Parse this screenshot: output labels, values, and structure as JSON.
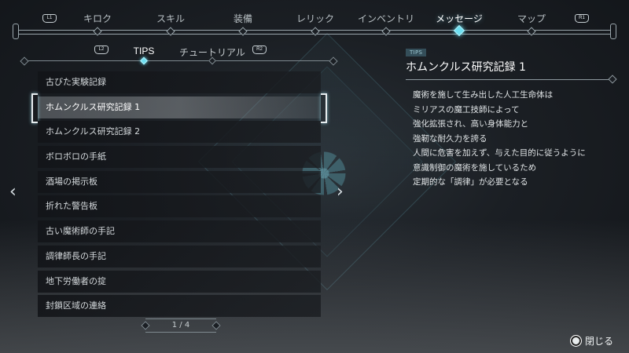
{
  "nav": {
    "left_button": "L1",
    "right_button": "R1",
    "tabs": [
      "キロク",
      "スキル",
      "装備",
      "レリック",
      "インベントリ",
      "メッセージ",
      "マップ"
    ],
    "active_index": 5
  },
  "subtabs": {
    "left_button": "L2",
    "right_button": "R2",
    "tabs": [
      "TIPS",
      "チュートリアル"
    ],
    "active_index": 0
  },
  "list": {
    "items": [
      "古びた実験記録",
      "ホムンクルス研究記録 1",
      "ホムンクルス研究記録 2",
      "ボロボロの手紙",
      "酒場の掲示板",
      "折れた警告板",
      "古い魔術師の手記",
      "調律師長の手記",
      "地下労働者の掟",
      "封鎖区域の連絡"
    ],
    "selected_index": 1,
    "page": "1 / 4"
  },
  "detail": {
    "category": "TIPS",
    "title": "ホムンクルス研究記録 1",
    "lines": [
      "魔術を施して生み出した人工生命体は",
      "ミリアスの魔工技師によって",
      "強化拡張され、高い身体能力と",
      "強靭な耐久力を誇る",
      "人間に危害を加えず、与えた目的に従うように",
      "意識制御の魔術を施しているため",
      "定期的な「調律」が必要となる"
    ]
  },
  "footer": {
    "close_label": "閉じる",
    "close_icon": "circle-button-icon"
  },
  "colors": {
    "accent": "#6ee0f2",
    "rail": "#9aa6ac"
  }
}
